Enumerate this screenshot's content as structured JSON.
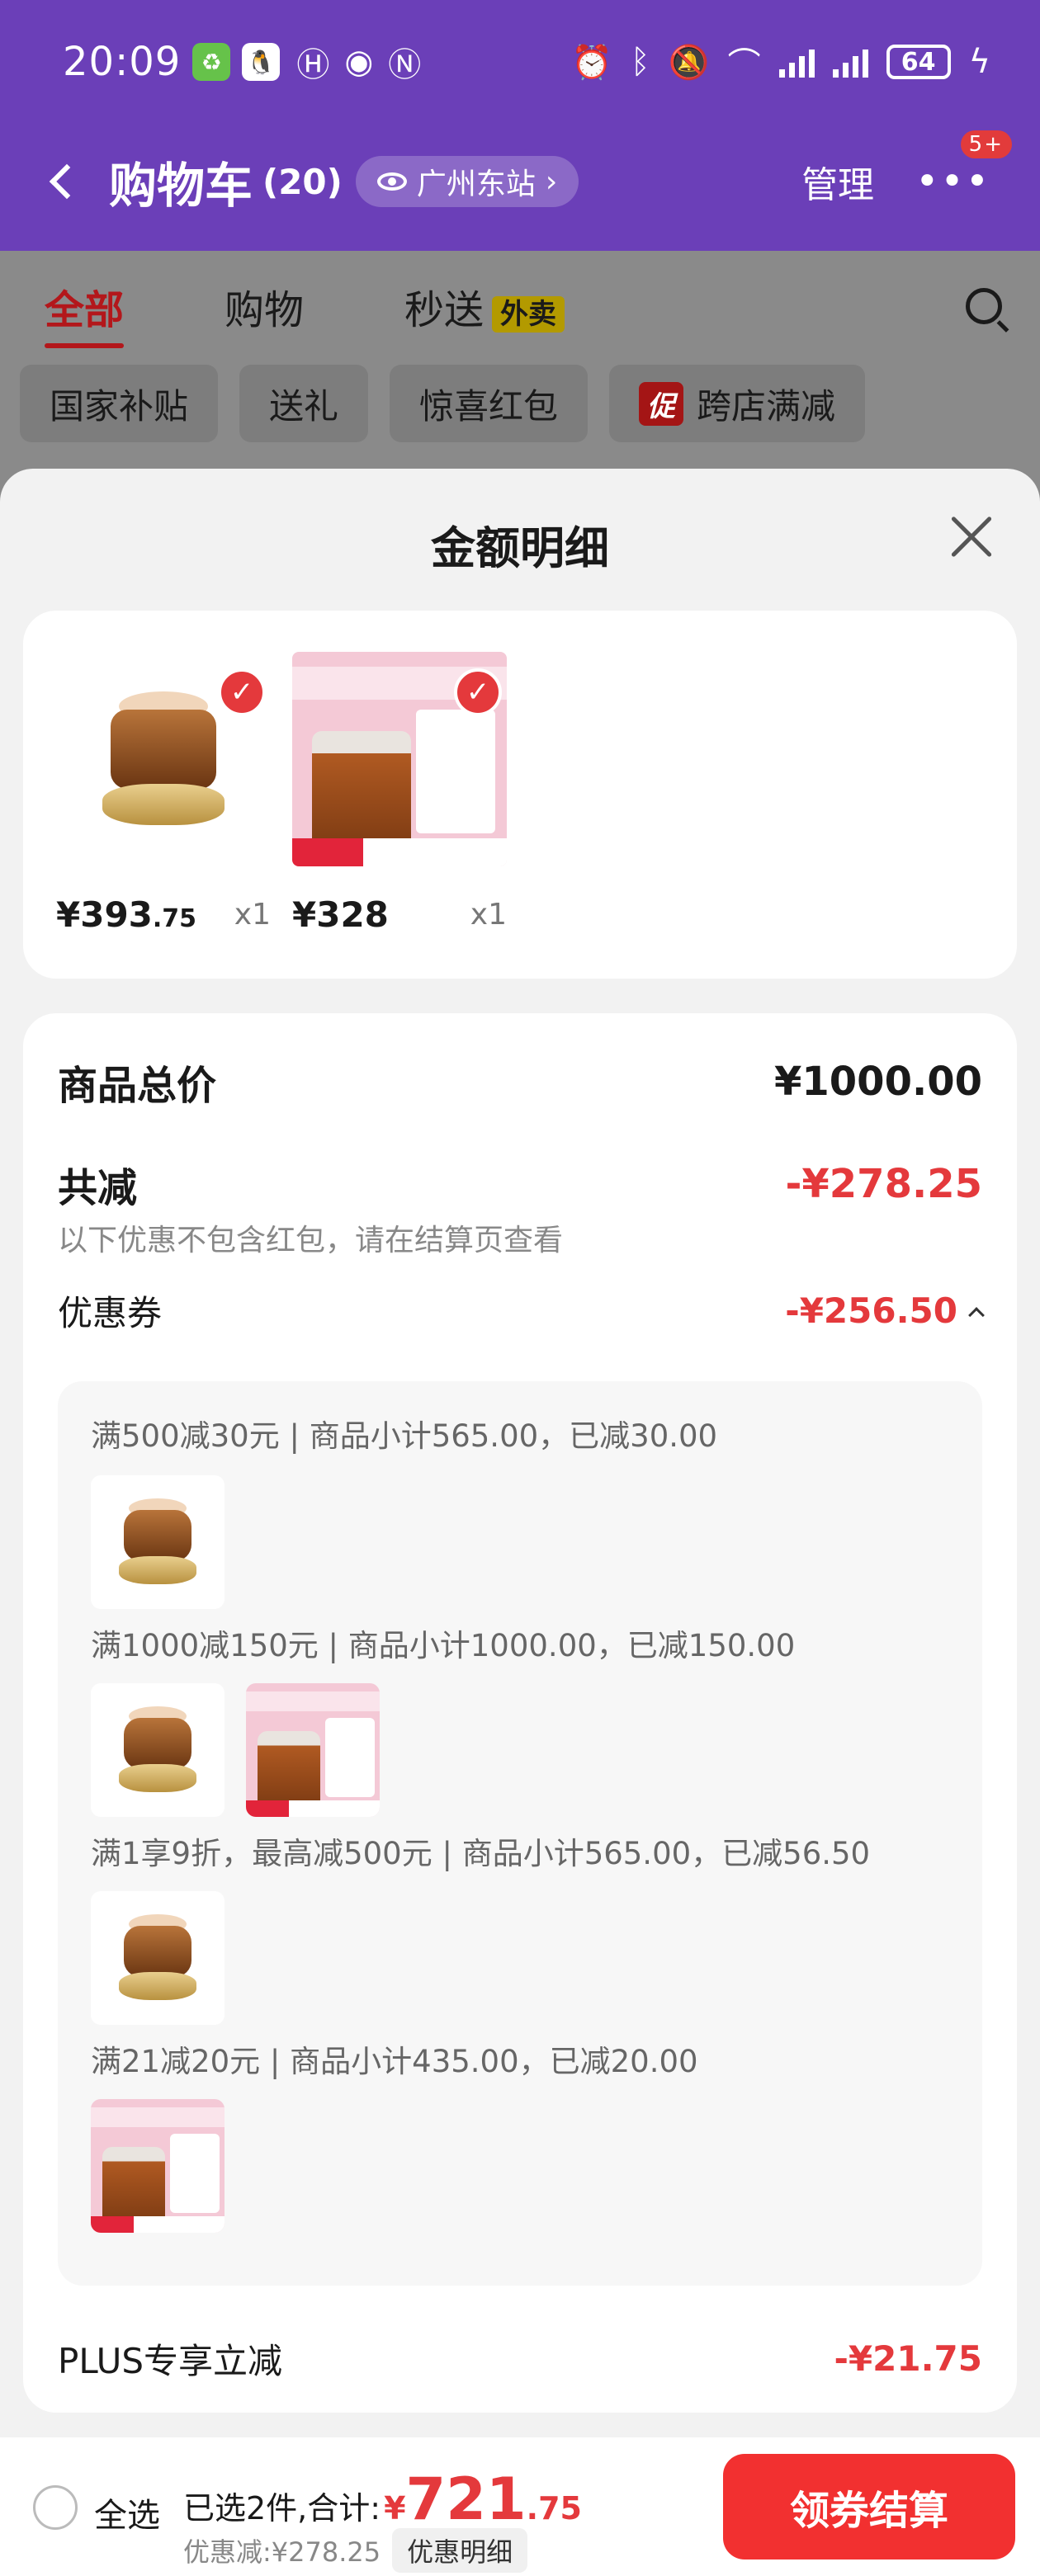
{
  "status_bar": {
    "time": "20:09",
    "battery": "64",
    "signal_label": "6"
  },
  "nav": {
    "title": "购物车",
    "count": "(20)",
    "location": "广州东站",
    "manage": "管理",
    "more": "•••",
    "badge": "5+"
  },
  "tabs": [
    {
      "label": "全部",
      "active": true
    },
    {
      "label": "购物"
    },
    {
      "label": "秒送",
      "tag": "外卖"
    }
  ],
  "chips": [
    {
      "label": "国家补贴"
    },
    {
      "label": "送礼"
    },
    {
      "label": "惊喜红包"
    },
    {
      "label": "跨店满减",
      "promo_tag": "促"
    }
  ],
  "sheet": {
    "title": "金额明细",
    "products": [
      {
        "name": "jar",
        "price_int": "¥393",
        "price_dec": ".75",
        "qty": "x1"
      },
      {
        "name": "hfp",
        "price_int": "¥328",
        "price_dec": "",
        "qty": "x1"
      }
    ],
    "breakdown": {
      "total_label": "商品总价",
      "total_value": "¥1000.00",
      "reduce_label": "共减",
      "reduce_value": "-¥278.25",
      "reduce_note": "以下优惠不包含红包，请在结算页查看",
      "coupon_label": "优惠券",
      "coupon_value": "-¥256.50",
      "coupon_lines": [
        "满500减30元 | 商品小计565.00，已减30.00",
        "满1000减150元 | 商品小计1000.00，已减150.00",
        "满1享9折，最高减500元 | 商品小计565.00，已减56.50",
        "满21减20元 | 商品小计435.00，已减20.00"
      ],
      "plus_label": "PLUS专享立减",
      "plus_value": "-¥21.75"
    }
  },
  "footer": {
    "select_all": "全选",
    "selected_text": "已选2件,合计:",
    "total_yen": "¥",
    "total_int": "721",
    "total_dec": ".75",
    "discount_text": "优惠减:¥278.25",
    "detail_pill": "优惠明细",
    "checkout": "领券结算"
  },
  "colors": {
    "header_purple": "#6b3fb8",
    "accent_red": "#e4393c",
    "checkout_red": "#f23030"
  }
}
